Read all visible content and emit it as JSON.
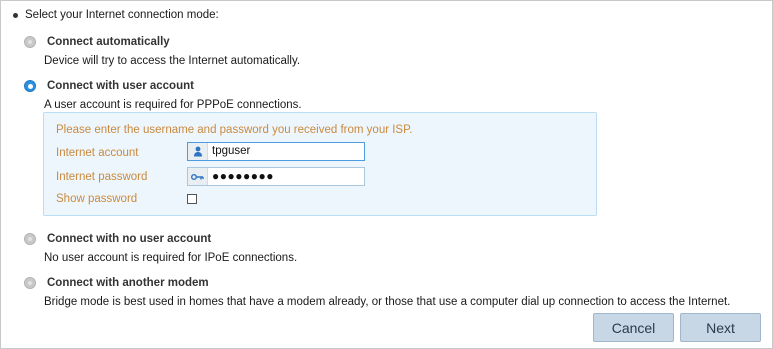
{
  "heading": "Select your Internet connection mode:",
  "options": [
    {
      "label": "Connect automatically",
      "description": "Device will try to access the Internet automatically.",
      "selected": false
    },
    {
      "label": "Connect with user account",
      "description": "A user account is required for PPPoE connections.",
      "selected": true
    },
    {
      "label": "Connect with no user account",
      "description": "No user account is required for IPoE connections.",
      "selected": false
    },
    {
      "label": "Connect with another modem",
      "description": "Bridge mode is best used in homes that have a modem already, or those that use a computer dial up connection to access the Internet.",
      "selected": false
    }
  ],
  "account_panel": {
    "hint": "Please enter the username and password you received from your ISP.",
    "account_label": "Internet account",
    "account_value": "tpguser",
    "account_icon": "user-icon",
    "password_label": "Internet password",
    "password_masked": "●●●●●●●●",
    "password_icon": "key-icon",
    "show_password_label": "Show password",
    "show_password_checked": false
  },
  "buttons": {
    "cancel": "Cancel",
    "next": "Next"
  },
  "colors": {
    "radio_selected": "#2c8fe0",
    "panel_bg": "#eef6fd",
    "field_label": "#c98a3e",
    "button_bg": "#c8d7e5"
  }
}
